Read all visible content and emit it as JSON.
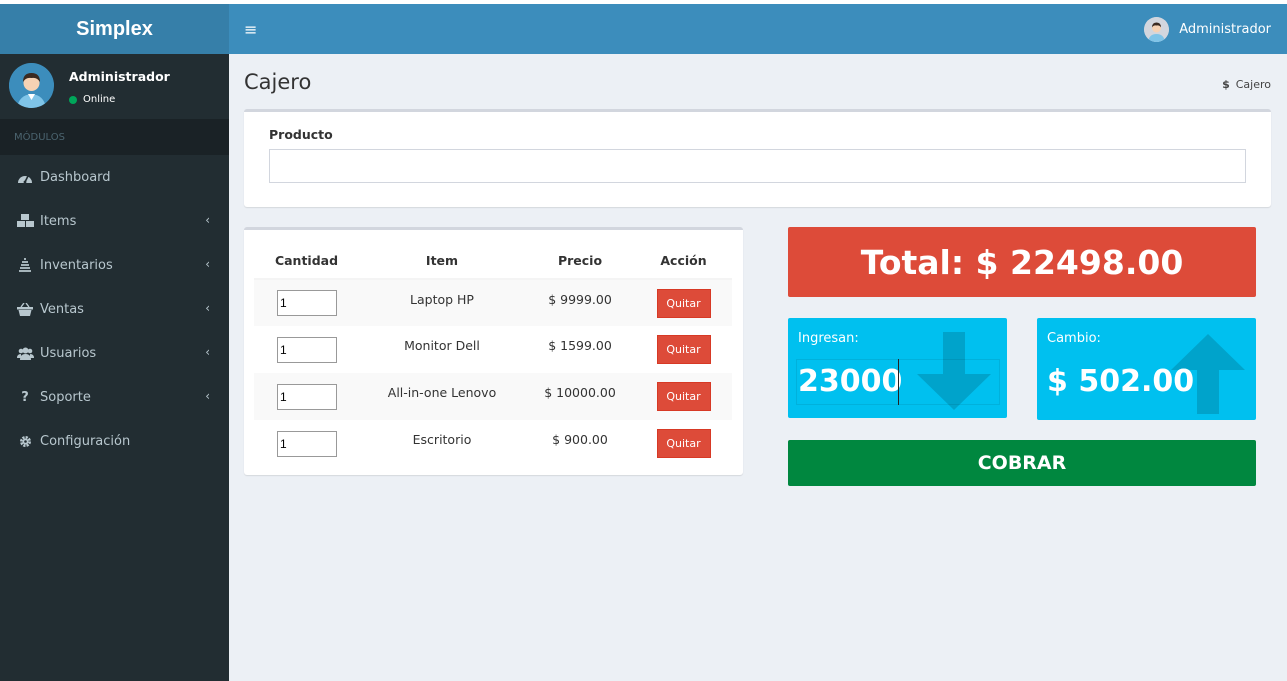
{
  "app": {
    "logo": "Simplex"
  },
  "sidebar": {
    "user": {
      "name": "Administrador",
      "status": "Online"
    },
    "section_header": "MÓDULOS",
    "items": [
      {
        "label": "Dashboard",
        "icon": "dashboard-icon",
        "has_children": false
      },
      {
        "label": "Items",
        "icon": "cubes-icon",
        "has_children": true
      },
      {
        "label": "Inventarios",
        "icon": "stack-icon",
        "has_children": true
      },
      {
        "label": "Ventas",
        "icon": "basket-icon",
        "has_children": true
      },
      {
        "label": "Usuarios",
        "icon": "users-icon",
        "has_children": true
      },
      {
        "label": "Soporte",
        "icon": "question-icon",
        "has_children": true
      },
      {
        "label": "Configuración",
        "icon": "gear-icon",
        "has_children": false
      }
    ]
  },
  "header": {
    "user_name": "Administrador"
  },
  "page": {
    "title": "Cajero",
    "breadcrumb": "Cajero",
    "breadcrumb_icon": "$"
  },
  "product": {
    "label": "Producto",
    "value": ""
  },
  "cart": {
    "headers": [
      "Cantidad",
      "Item",
      "Precio",
      "Acción"
    ],
    "rows": [
      {
        "qty": "1",
        "item": "Laptop HP",
        "price": "$ 9999.00",
        "action": "Quitar"
      },
      {
        "qty": "1",
        "item": "Monitor Dell",
        "price": "$ 1599.00",
        "action": "Quitar"
      },
      {
        "qty": "1",
        "item": "All-in-one Lenovo",
        "price": "$ 10000.00",
        "action": "Quitar"
      },
      {
        "qty": "1",
        "item": "Escritorio",
        "price": "$ 900.00",
        "action": "Quitar"
      }
    ]
  },
  "totals": {
    "total_text": "Total: $ 22498.00",
    "ingresan_label": "Ingresan:",
    "ingresan_value": "23000",
    "cambio_label": "Cambio:",
    "cambio_value": "$ 502.00",
    "cobrar_label": "COBRAR"
  },
  "colors": {
    "header": "#3c8dbc",
    "logo_bg": "#367fa9",
    "sidebar": "#222d32",
    "danger": "#dd4b39",
    "info": "#00c0ef",
    "success": "#00873f"
  }
}
